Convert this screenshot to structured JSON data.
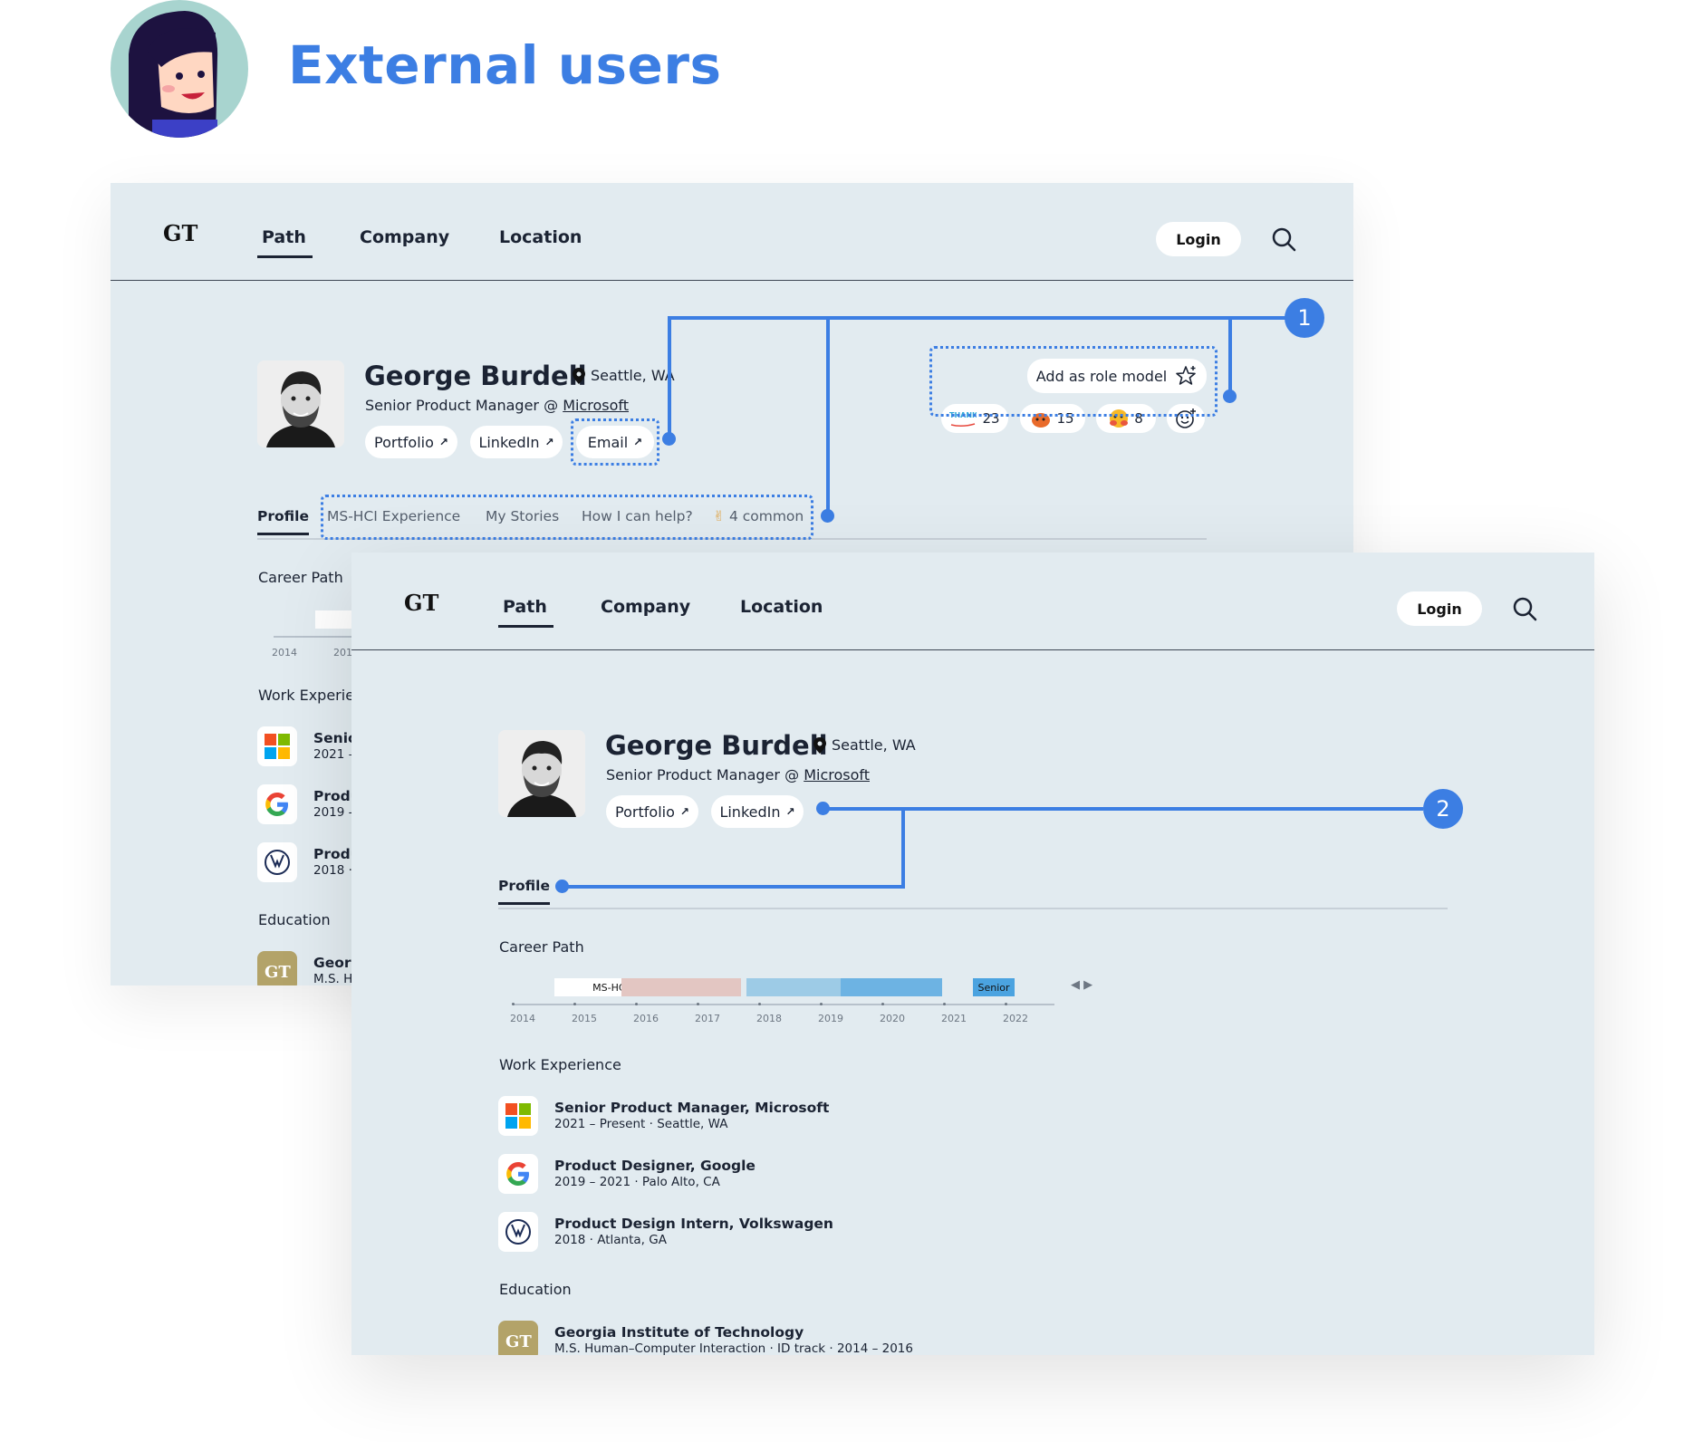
{
  "hero": {
    "title": "External users"
  },
  "nav": {
    "logo": "GT",
    "tabs": [
      "Path",
      "Company",
      "Location"
    ],
    "login": "Login",
    "search_icon": "search-icon"
  },
  "profile": {
    "name": "George Burdell",
    "location": "Seattle, WA",
    "role": "Senior Product Manager @ ",
    "company": "Microsoft",
    "links": [
      "Portfolio",
      "LinkedIn",
      "Email"
    ],
    "role_model_button": "Add as role model",
    "reactions": [
      {
        "icon": "thank-you-sticker-icon",
        "label": "THANK YOU!",
        "count": "23"
      },
      {
        "icon": "face-emoji-icon",
        "count": "15"
      },
      {
        "icon": "hugging-emoji-icon",
        "count": "8"
      }
    ],
    "tabs_a": [
      "Profile",
      "MS-HCI Experience",
      "My Stories",
      "How I can help?",
      "4 common"
    ],
    "tabs_b": [
      "Profile"
    ]
  },
  "callouts": {
    "one": "1",
    "two": "2"
  },
  "sections": {
    "career_path": "Career Path",
    "work_experience": "Work Experience",
    "education": "Education"
  },
  "career_path": {
    "years": [
      "2014",
      "2015",
      "2016",
      "2017",
      "2018",
      "2019",
      "2020",
      "2021",
      "2022"
    ],
    "bars": [
      {
        "label": "MS-HCI",
        "color": "#ffffff"
      },
      {
        "label": "",
        "color": "#e3c6c2"
      },
      {
        "label": "",
        "color": "#9dcbe6"
      },
      {
        "label": "",
        "color": "#6db3e3"
      },
      {
        "label": "Senior",
        "color": "#4ba3e0"
      }
    ]
  },
  "work": [
    {
      "title": "Senior Product Manager, Microsoft",
      "sub": "2021 – Present · Seattle, WA",
      "short_title": "Senio",
      "short_sub": "2021 –"
    },
    {
      "title": "Product Designer, Google",
      "sub": "2019 – 2021 · Palo Alto, CA",
      "short_title": "Produ",
      "short_sub": "2019 -"
    },
    {
      "title": "Product Design Intern, Volkswagen",
      "sub": "2018 · Atlanta, GA",
      "short_title": "Produ",
      "short_sub": "2018 ·"
    }
  ],
  "education": {
    "title": "Georgia Institute of Technology",
    "sub": "M.S. Human–Computer Interaction · ID track · 2014 – 2016",
    "short_title": "Georg",
    "short_sub": "M.S. H"
  },
  "a_cut": {
    "work_experience": "Work Experier",
    "year_2015": "201"
  }
}
